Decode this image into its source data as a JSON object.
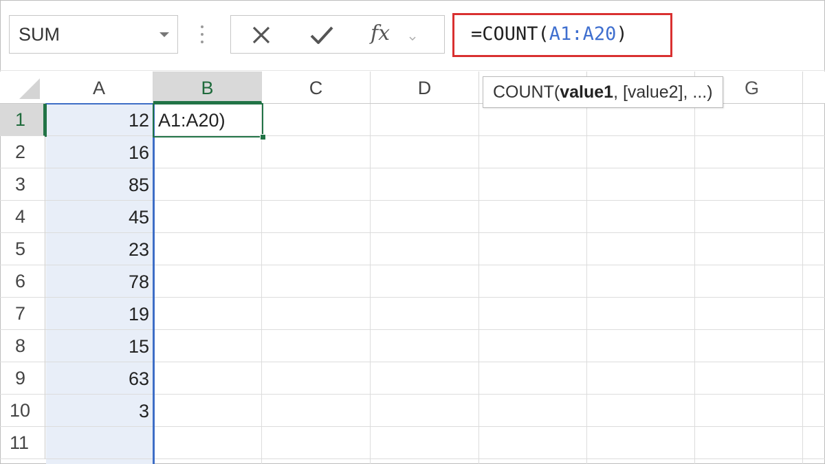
{
  "name_box": {
    "value": "SUM"
  },
  "formula_bar": {
    "cancel_icon": "close-icon",
    "enter_icon": "check-icon",
    "fx_label": "fx",
    "formula_prefix": "=COUNT(",
    "formula_ref": "A1:A20",
    "formula_suffix": ")"
  },
  "tooltip": {
    "func": "COUNT(",
    "arg_bold": "value1",
    "rest": ", [value2], ...)"
  },
  "columns": [
    "A",
    "B",
    "C",
    "D",
    "",
    "",
    "G"
  ],
  "rows": [
    "1",
    "2",
    "3",
    "4",
    "5",
    "6",
    "7",
    "8",
    "9",
    "10",
    "11"
  ],
  "column_a_values": [
    "12",
    "16",
    "85",
    "45",
    "23",
    "78",
    "19",
    "15",
    "63",
    "3",
    ""
  ],
  "active_cell": {
    "text": "A1:A20)"
  },
  "colors": {
    "highlight_red": "#d93030",
    "range_blue": "#3f6fcf",
    "excel_green": "#217346"
  }
}
